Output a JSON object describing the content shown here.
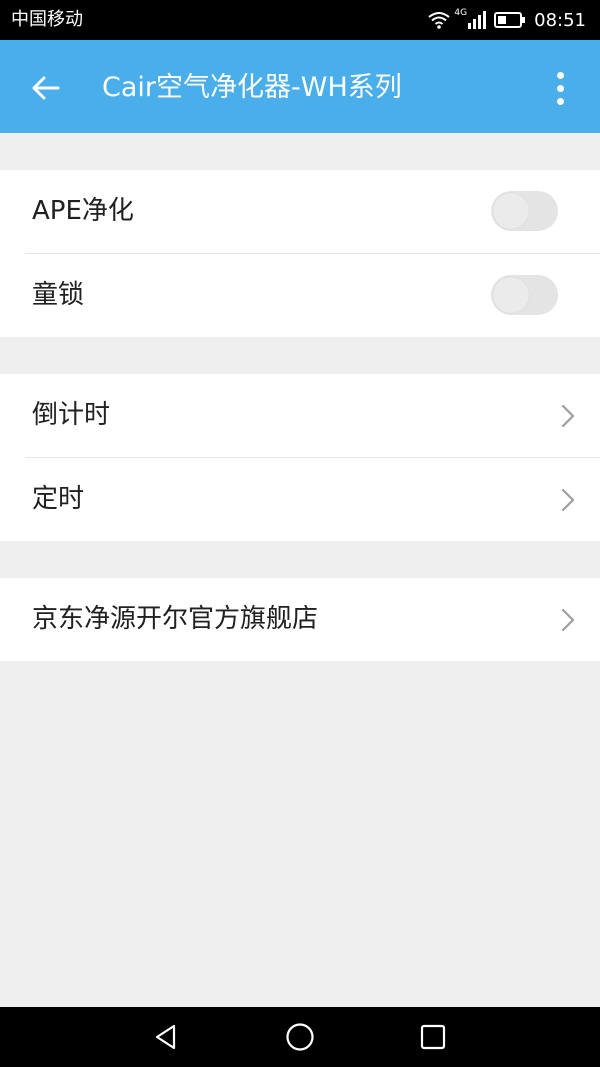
{
  "status_bar": {
    "carrier": "中国移动",
    "network": "4G",
    "time": "08:51"
  },
  "app_bar": {
    "title": "Cair空气净化器-WH系列",
    "back_icon": "arrow-left-icon",
    "more_icon": "more-vertical-icon"
  },
  "toggles": [
    {
      "label": "APE净化",
      "on": false
    },
    {
      "label": "童锁",
      "on": false
    }
  ],
  "timers": [
    {
      "label": "倒计时"
    },
    {
      "label": "定时"
    }
  ],
  "shop": {
    "label": "京东净源开尔官方旗舰店"
  },
  "nav_bar": {
    "back_icon": "triangle-back-icon",
    "home_icon": "circle-home-icon",
    "recents_icon": "square-recents-icon"
  },
  "colors": {
    "app_bar": "#4aaeea",
    "background": "#efefef",
    "toggle_off": "#e4e4e4"
  }
}
